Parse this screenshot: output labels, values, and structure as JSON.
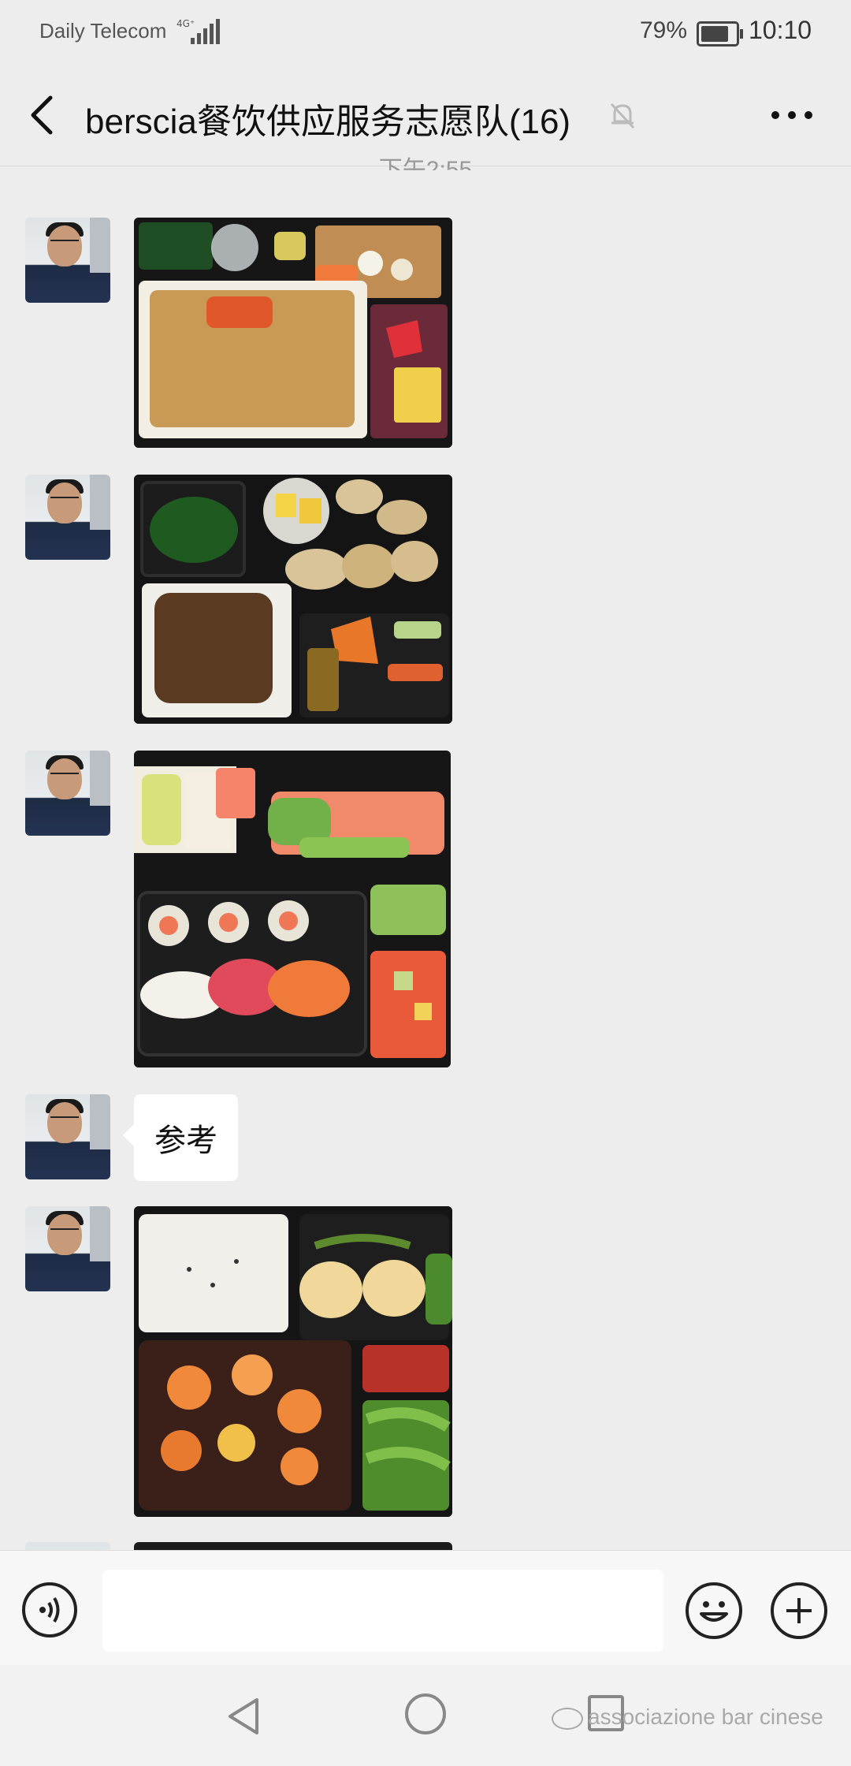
{
  "status_bar": {
    "carrier": "Daily Telecom",
    "network": "4G⁺",
    "battery_percent": "79%",
    "time": "10:10"
  },
  "header": {
    "back_icon": "chevron-left-icon",
    "title": "berscia餐饮供应服务志愿队(16)",
    "mute_icon": "bell-off-icon",
    "more_icon": "ellipsis-icon"
  },
  "chat": {
    "partial_timestamp": "下午2:55",
    "messages": [
      {
        "type": "image",
        "content": "bento-photo"
      },
      {
        "type": "image",
        "content": "bento-photo"
      },
      {
        "type": "image",
        "content": "sushi-photo"
      },
      {
        "type": "text",
        "text": "参考"
      },
      {
        "type": "image",
        "content": "bento-photo"
      }
    ]
  },
  "input_bar": {
    "voice_icon": "voice-icon",
    "text_value": "",
    "emoji_icon": "emoji-icon",
    "plus_icon": "plus-icon"
  },
  "nav_bar": {
    "back": "triangle-back-icon",
    "home": "circle-home-icon",
    "recents": "square-recents-icon"
  },
  "watermark": "associazione bar cinese"
}
